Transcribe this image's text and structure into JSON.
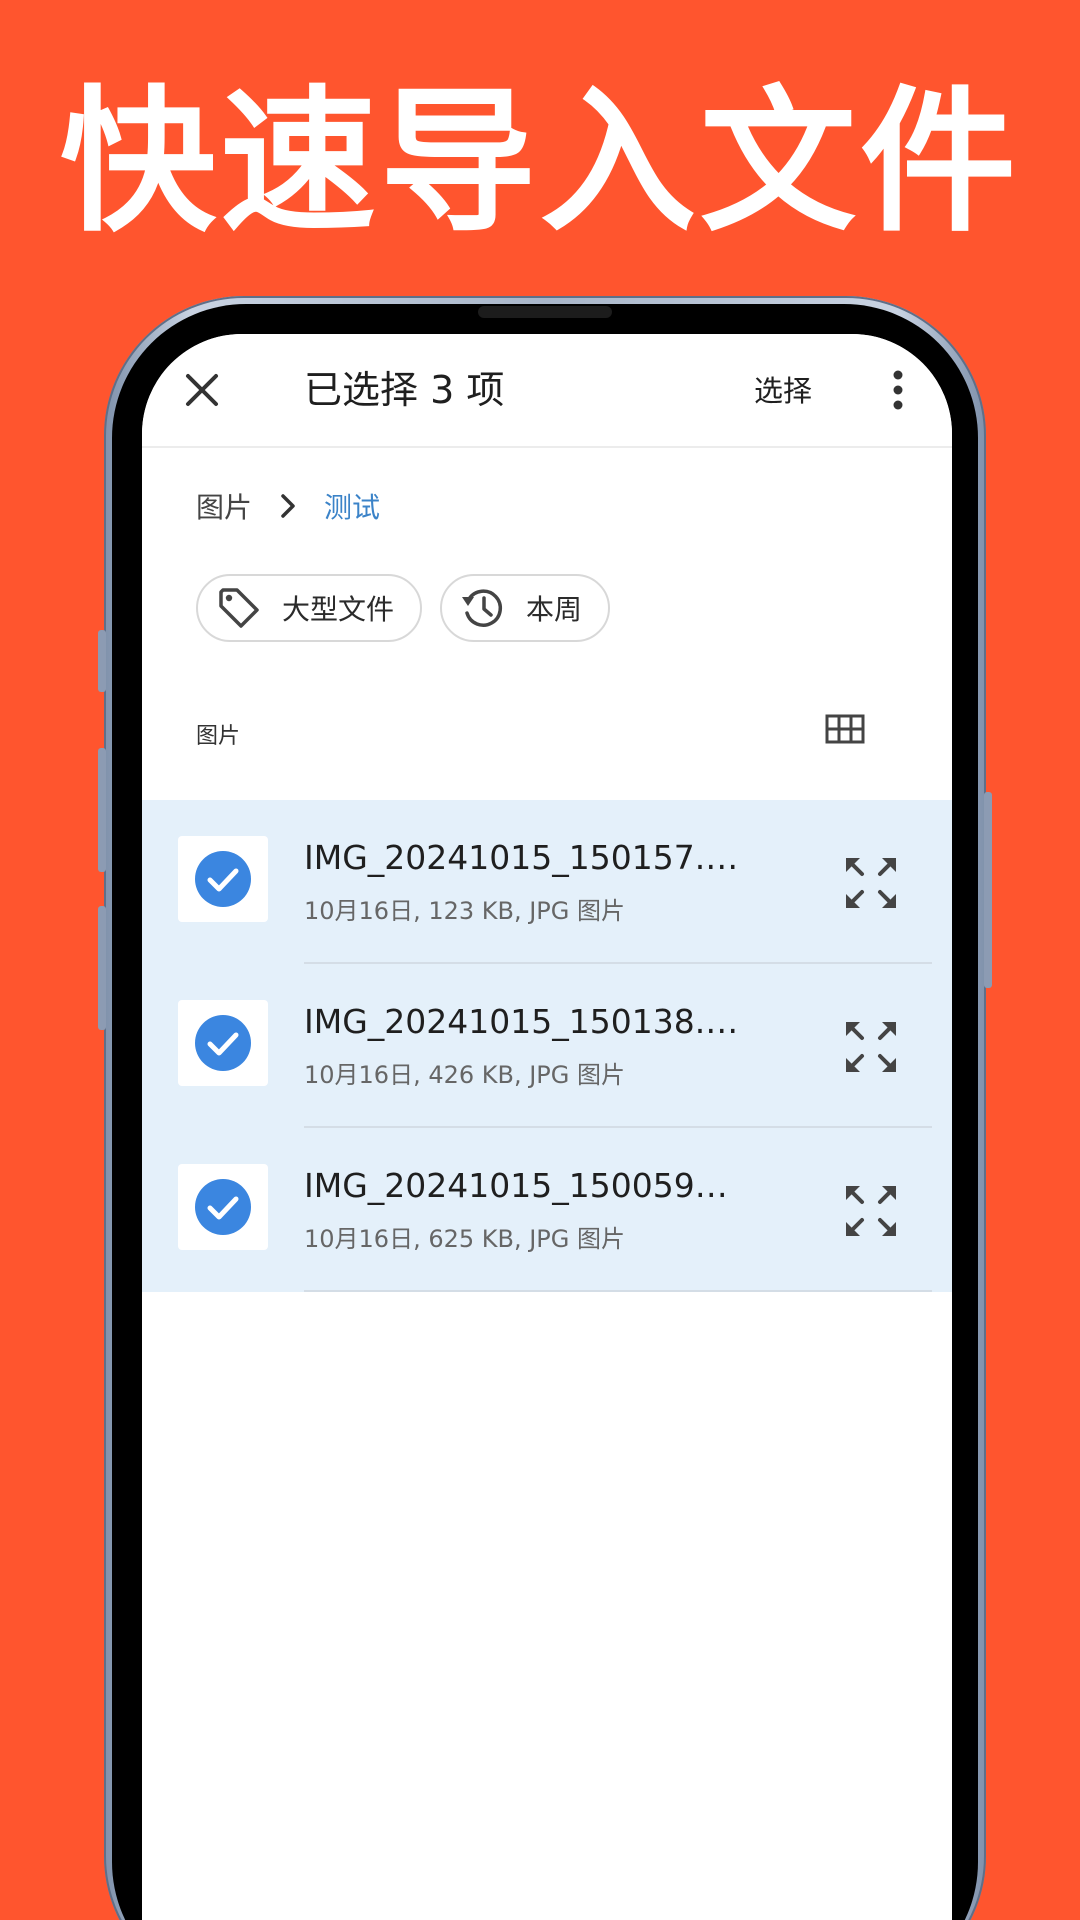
{
  "headline": "快速导入文件",
  "topbar": {
    "title": "已选择 3 项",
    "select_label": "选择"
  },
  "breadcrumb": {
    "root": "图片",
    "current": "测试"
  },
  "chips": [
    {
      "label": "大型文件",
      "icon": "tag-icon"
    },
    {
      "label": "本周",
      "icon": "history-icon"
    }
  ],
  "section": {
    "label": "图片"
  },
  "files": [
    {
      "name": "IMG_20241015_150157.…",
      "meta": "10月16日, 123 KB, JPG 图片",
      "selected": true
    },
    {
      "name": "IMG_20241015_150138.…",
      "meta": "10月16日, 426 KB, JPG 图片",
      "selected": true
    },
    {
      "name": "IMG_20241015_150059…",
      "meta": "10月16日, 625 KB, JPG 图片",
      "selected": true
    }
  ],
  "colors": {
    "background": "#FF552E",
    "selection": "#E4F0FA",
    "accent": "#3B86E0",
    "link": "#3B83C8"
  }
}
